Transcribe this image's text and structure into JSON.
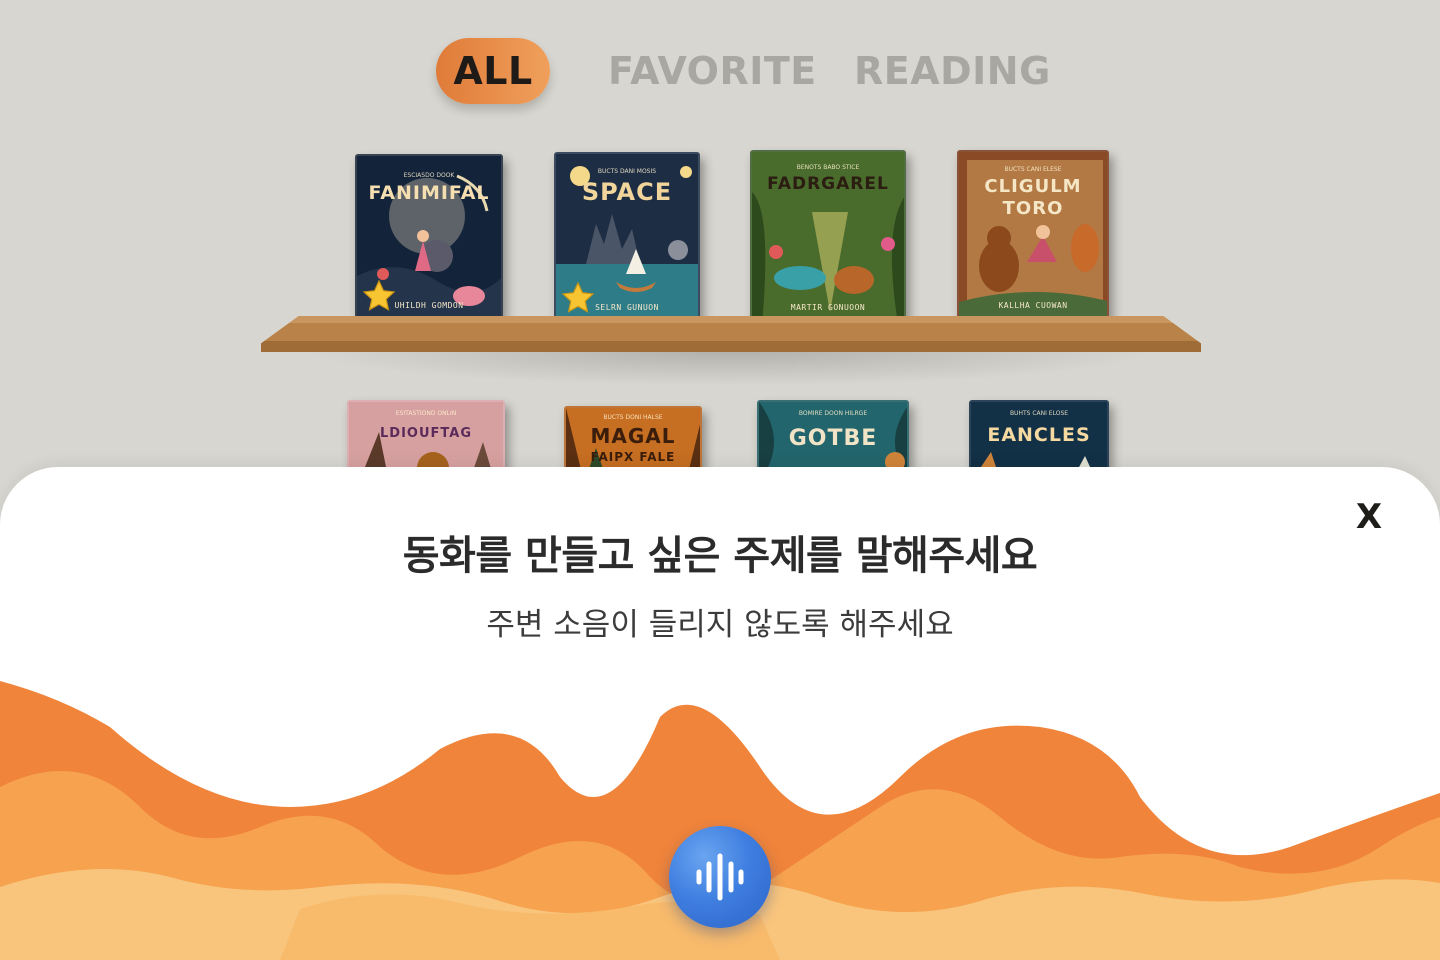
{
  "tabs": {
    "all": "ALL",
    "favorite": "FAVORITE",
    "reading": "READING",
    "active": "all"
  },
  "shelf": {
    "row1": [
      {
        "title_line1": "FANIMIFAL",
        "title_line2": "",
        "subtitle": "ESCIASDO DOOK",
        "author": "UHILDH GOMDON",
        "favorite": true
      },
      {
        "title_line1": "SPACE",
        "title_line2": "",
        "subtitle": "BUCTS DANI MOSIS",
        "author": "SELRN GUNUON",
        "favorite": true
      },
      {
        "title_line1": "FADRGAREL",
        "title_line2": "",
        "subtitle": "BENOTS BABO STICE",
        "author": "MARTIR GONUOON",
        "favorite": false
      },
      {
        "title_line1": "CLIGULM",
        "title_line2": "TORO",
        "subtitle": "BUCTS CANI ELESE",
        "author": "KALLHA CUOWAN",
        "favorite": false
      }
    ],
    "row2": [
      {
        "title_line1": "LDIOUFTAG",
        "title_line2": "",
        "subtitle": "ESITASTIOND ONLIN"
      },
      {
        "title_line1": "MAGAL",
        "title_line2": "FAIPX FALE",
        "subtitle": "BUCTS DONI HALSE"
      },
      {
        "title_line1": "GOTBE",
        "title_line2": "",
        "subtitle": "BOMIRE DOON HILRGE"
      },
      {
        "title_line1": "EANCLES",
        "title_line2": "",
        "subtitle": "BUHTS CANI ELOSE"
      }
    ]
  },
  "sheet": {
    "title": "동화를 만들고 싶은 주제를 말해주세요",
    "subtitle": "주변 소음이 들리지 않도록 해주세요",
    "close_label": "X"
  },
  "colors": {
    "background": "#d8d6d0",
    "accent": "#e07b39",
    "tab_inactive": "#a9a7a2",
    "wave_dark": "#f0843a",
    "wave_mid": "#f6a24e",
    "wave_light": "#f9c57d",
    "mic": "#3f7fe0"
  },
  "icons": {
    "favorite": "star-icon",
    "mic": "voice-wave-icon",
    "close": "close-icon"
  }
}
